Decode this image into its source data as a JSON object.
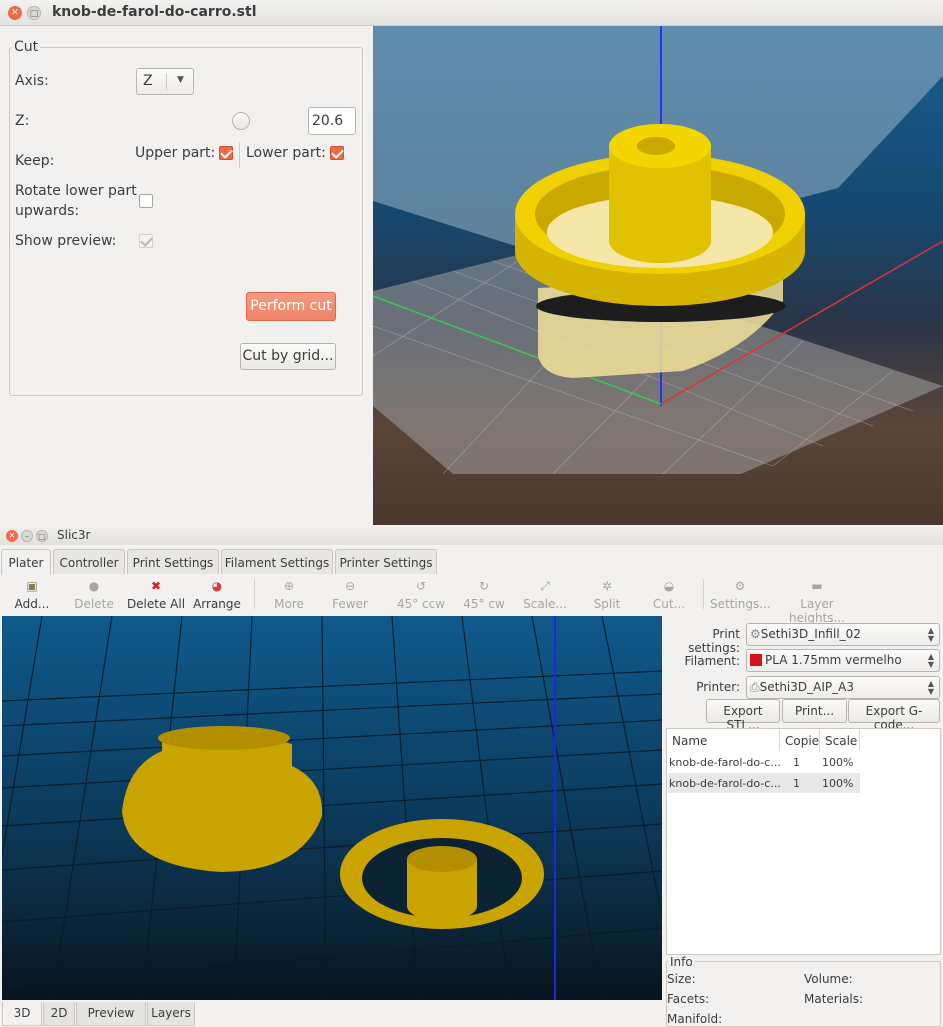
{
  "cut_window": {
    "title": "knob-de-farol-do-carro.stl",
    "group_title": "Cut",
    "axis_label": "Axis:",
    "axis_value": "Z",
    "z_label": "Z:",
    "z_value": "20.6",
    "keep_label": "Keep:",
    "upper_label": "Upper part:",
    "upper_checked": true,
    "lower_label": "Lower part:",
    "lower_checked": true,
    "rotate_label_1": "Rotate lower part",
    "rotate_label_2": "upwards:",
    "rotate_checked": false,
    "preview_label": "Show preview:",
    "preview_checked": true,
    "perform_cut": "Perform cut",
    "cut_by_grid": "Cut by grid..."
  },
  "slic3r": {
    "title": "Slic3r",
    "tabs": [
      "Plater",
      "Controller",
      "Print Settings",
      "Filament Settings",
      "Printer Settings"
    ],
    "toolbar": [
      {
        "label": "Add...",
        "icon": "add-icon",
        "enabled": true
      },
      {
        "label": "Delete",
        "icon": "delete-icon",
        "enabled": false
      },
      {
        "label": "Delete All",
        "icon": "delete-all-icon",
        "enabled": true
      },
      {
        "label": "Arrange",
        "icon": "arrange-icon",
        "enabled": true
      },
      {
        "label": "More",
        "icon": "more-icon",
        "enabled": false
      },
      {
        "label": "Fewer",
        "icon": "fewer-icon",
        "enabled": false
      },
      {
        "label": "45° ccw",
        "icon": "rotate-ccw-icon",
        "enabled": false
      },
      {
        "label": "45° cw",
        "icon": "rotate-cw-icon",
        "enabled": false
      },
      {
        "label": "Scale...",
        "icon": "scale-icon",
        "enabled": false
      },
      {
        "label": "Split",
        "icon": "split-icon",
        "enabled": false
      },
      {
        "label": "Cut...",
        "icon": "cut-icon",
        "enabled": false
      },
      {
        "label": "Settings...",
        "icon": "settings-icon",
        "enabled": false
      },
      {
        "label": "Layer heights...",
        "icon": "layers-icon",
        "enabled": false
      }
    ],
    "print_settings_label": "Print settings:",
    "print_settings_value": "Sethi3D_Infill_02",
    "filament_label": "Filament:",
    "filament_value": "PLA 1.75mm vermelho",
    "filament_color": "#d4131b",
    "printer_label": "Printer:",
    "printer_value": "Sethi3D_AIP_A3",
    "export_stl": "Export STL...",
    "print": "Print...",
    "export_gcode": "Export G-code...",
    "object_list": {
      "headers": [
        "Name",
        "Copie",
        "Scale"
      ],
      "rows": [
        {
          "name": "knob-de-farol-do-c...",
          "copies": "1",
          "scale": "100%"
        },
        {
          "name": "knob-de-farol-do-c...",
          "copies": "1",
          "scale": "100%"
        }
      ]
    },
    "info": {
      "title": "Info",
      "size": "Size:",
      "volume": "Volume:",
      "facets": "Facets:",
      "materials": "Materials:",
      "manifold": "Manifold:"
    },
    "view_tabs": [
      "3D",
      "2D",
      "Preview",
      "Layers"
    ],
    "accent_color": "#ef6a45",
    "model_color": "#e6c800"
  }
}
